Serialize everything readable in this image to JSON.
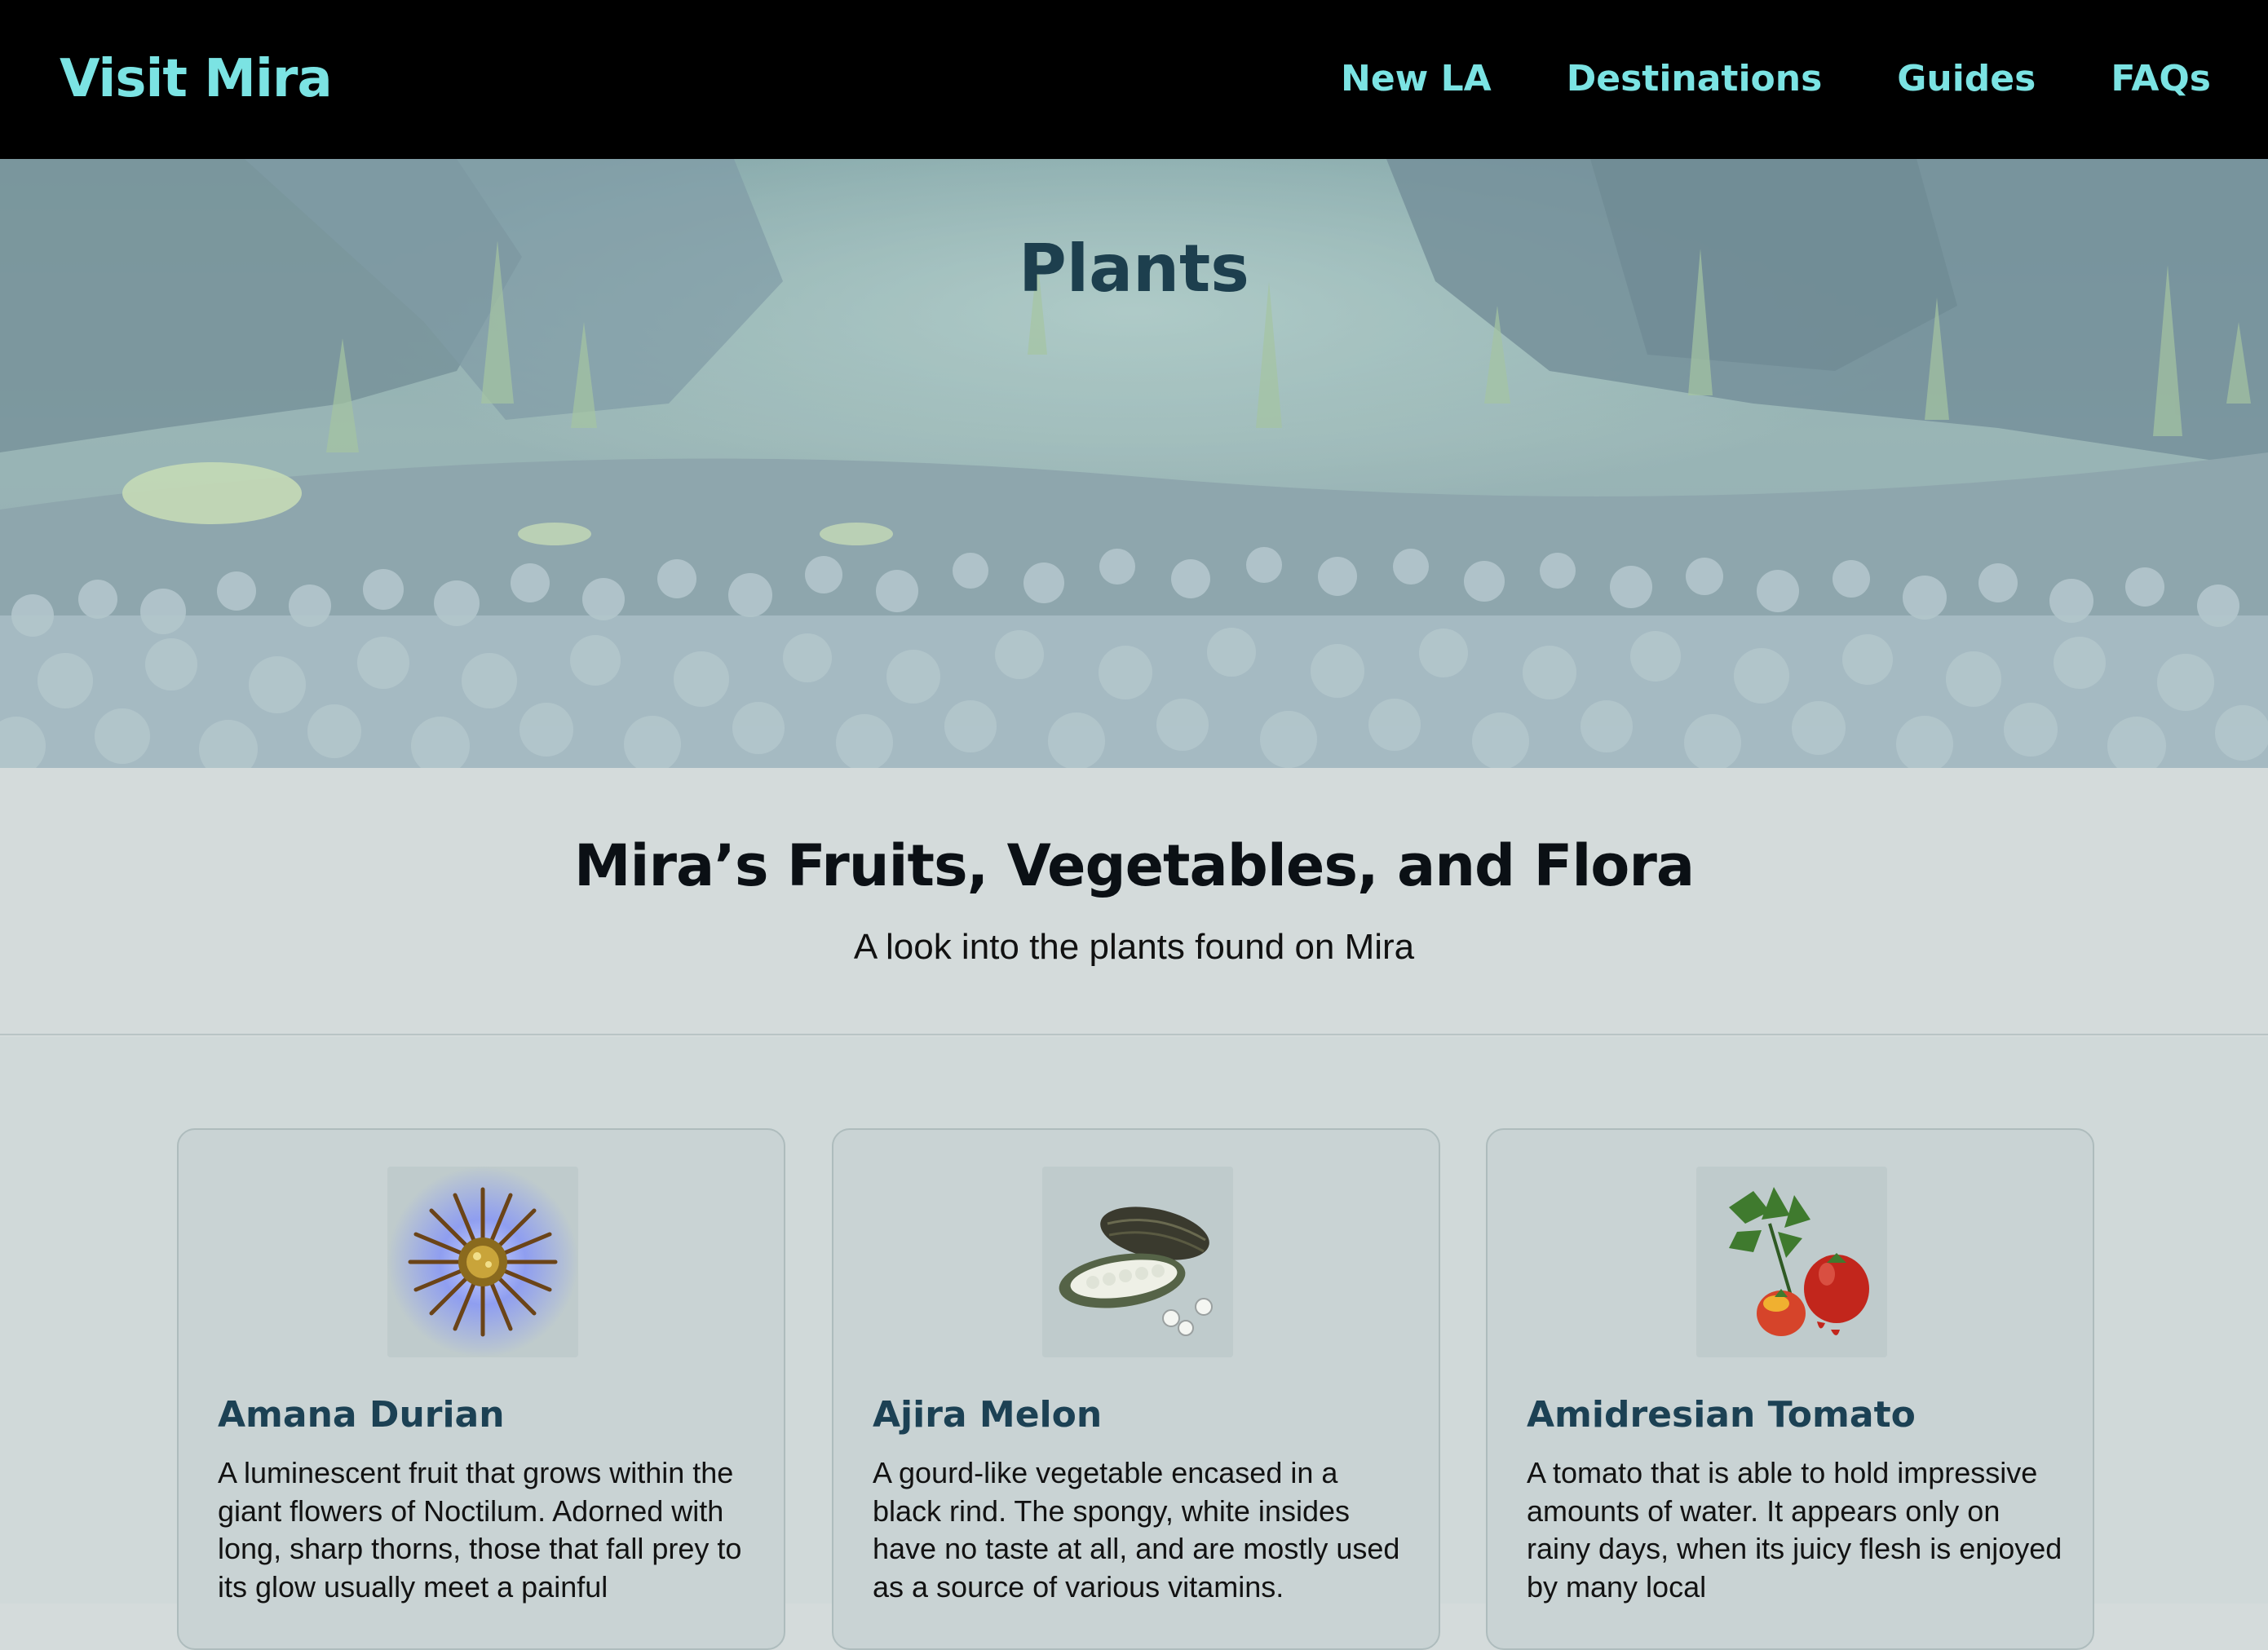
{
  "nav": {
    "brand": "Visit Mira",
    "links": [
      {
        "label": "New LA"
      },
      {
        "label": "Destinations"
      },
      {
        "label": "Guides"
      },
      {
        "label": "FAQs"
      }
    ]
  },
  "hero": {
    "title": "Plants"
  },
  "intro": {
    "heading": "Mira’s Fruits, Vegetables, and Flora",
    "subheading": "A look into the plants found on Mira"
  },
  "cards": [
    {
      "title": "Amana Durian",
      "icon": "spiky-fruit-icon",
      "description": "A luminescent fruit that grows within the giant flowers of Noctilum. Adorned with long, sharp thorns, those that fall prey to its glow usually meet a painful"
    },
    {
      "title": "Ajira Melon",
      "icon": "gourd-melon-icon",
      "description": "A gourd-like vegetable encased in a black rind. The spongy, white insides have no taste at all, and are mostly used as a source of various vitamins."
    },
    {
      "title": "Amidresian Tomato",
      "icon": "tomato-icon",
      "description": "A tomato that is able to hold impressive amounts of water. It appears only on rainy days, when its juicy flesh is enjoyed by many local"
    }
  ],
  "colors": {
    "nav_bg": "#000000",
    "nav_text": "#7be3e3",
    "hero_title": "#1d3f4e",
    "card_title": "#1c4154",
    "page_bg": "#d4dbdb"
  }
}
